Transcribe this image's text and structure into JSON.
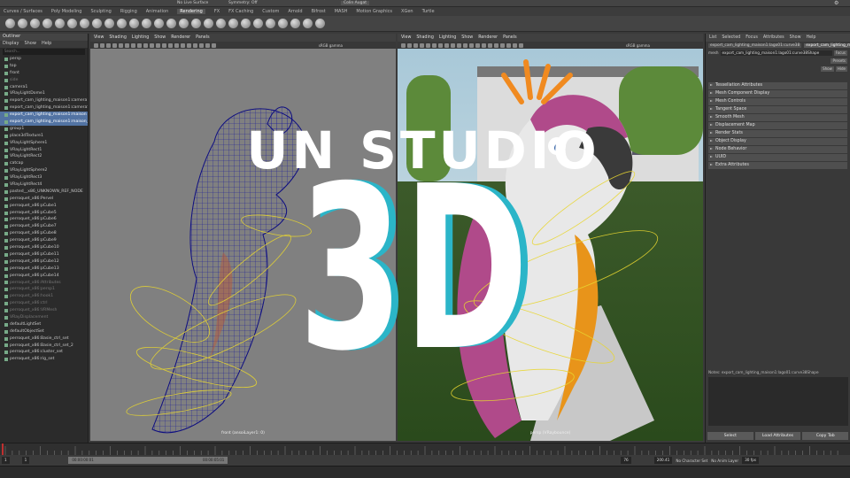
{
  "top_menu": {
    "shading_mode": "No Live Surface",
    "symmetry": "Symmetry: Off",
    "user": "Colin Augat"
  },
  "shelf_tabs": [
    "Curves / Surfaces",
    "Poly Modeling",
    "Sculpting",
    "Rigging",
    "Animation",
    "Rendering",
    "FX",
    "FX Caching",
    "Custom",
    "Arnold",
    "Bifrost",
    "MASH",
    "Motion Graphics",
    "XGen",
    "Turtle"
  ],
  "outliner": {
    "title": "Outliner",
    "menu": [
      "Display",
      "Show",
      "Help"
    ],
    "search_placeholder": "Search...",
    "items": [
      "persp",
      "top",
      "front",
      "side",
      "camera1",
      "VRayLightDome1",
      "export_cam_lighting_maison1:camera1",
      "export_cam_lighting_maison1:cameraShape1",
      "export_cam_lighting_maison1:maison",
      "export_cam_lighting_maison1:maison_2",
      "group1",
      "place3dTexture1",
      "VRayLightSphere1",
      "VRayLightRect1",
      "VRayLightRect2",
      "catcap",
      "VRayLightSphere2",
      "VRayLightRect3",
      "VRayLightRect4",
      "pasted__x86_UNKNOWN_REF_NODE",
      "perroquet_x86:Pervel",
      "perroquet_x86:pCube1",
      "perroquet_x86:pCube5",
      "perroquet_x86:pCube6",
      "perroquet_x86:pCube7",
      "perroquet_x86:pCube8",
      "perroquet_x86:pCube9",
      "perroquet_x86:pCube10",
      "perroquet_x86:pCube11",
      "perroquet_x86:pCube12",
      "perroquet_x86:pCube13",
      "perroquet_x86:pCube14",
      "perroquet_x86:Attributes",
      "perroquet_x86:persp1",
      "perroquet_x86:hook1",
      "perroquet_x86:ctrl",
      "perroquet_x86:VRMesh",
      "VRayDisplacement",
      "defaultLightSet",
      "defaultObjectSet",
      "perroquet_x86:Basie_ctrl_set",
      "perroquet_x86:Basie_ctrl_set_2",
      "perroquet_x86:cluster_set",
      "perroquet_x86:rig_set"
    ]
  },
  "viewport_menu": [
    "View",
    "Shading",
    "Lighting",
    "Show",
    "Renderer",
    "Panels"
  ],
  "viewport_left": {
    "label": "front (ansoiLayer1: 0)",
    "color_space": "sRGB gamma",
    "near": "0.00",
    "far": "1.00"
  },
  "viewport_right": {
    "label": "persp (VRaybounce)",
    "color_space": "sRGB gamma",
    "near": "0.00",
    "far": "1.00"
  },
  "attribute_editor": {
    "menu": [
      "List",
      "Selected",
      "Focus",
      "Attributes",
      "Show",
      "Help"
    ],
    "node_tabs": [
      "export_cam_lighting_maison1:lago01:curve38",
      "export_cam_lighting_maison1:lago01:curve38Shape"
    ],
    "mesh_label": "mesh",
    "mesh_value": "export_cam_lighting_maison1:lago01:curve38Shape",
    "focus_btn": "Focus",
    "presets_btn": "Presets",
    "show_btn": "Show",
    "hide_btn": "Hide",
    "sections": [
      "Tessellation Attributes",
      "Mesh Component Display",
      "Mesh Controls",
      "Tangent Space",
      "Smooth Mesh",
      "Displacement Map",
      "Render Stats",
      "Object Display",
      "Node Behavior",
      "UUID",
      "Extra Attributes"
    ],
    "notes": "Notes: export_cam_lighting_maison1:lago01:curve38Shape",
    "buttons": [
      "Select",
      "Load Attributes",
      "Copy Tab"
    ]
  },
  "timeline": {
    "start": "1",
    "end": "120",
    "current": "1",
    "range_start": "00:00:00:01",
    "range_end": "00:00:05:01",
    "end_frame": "76",
    "playback": "200.41",
    "char_set": "No Character Set",
    "anim_layer": "No Anim Layer",
    "fps": "30 fps"
  },
  "overlay": {
    "line1": "UN STUDIO",
    "line2": "3D"
  },
  "colors": {
    "accent": "#2bb5c8",
    "text": "#ffffff",
    "highlight": "#5273a3"
  }
}
